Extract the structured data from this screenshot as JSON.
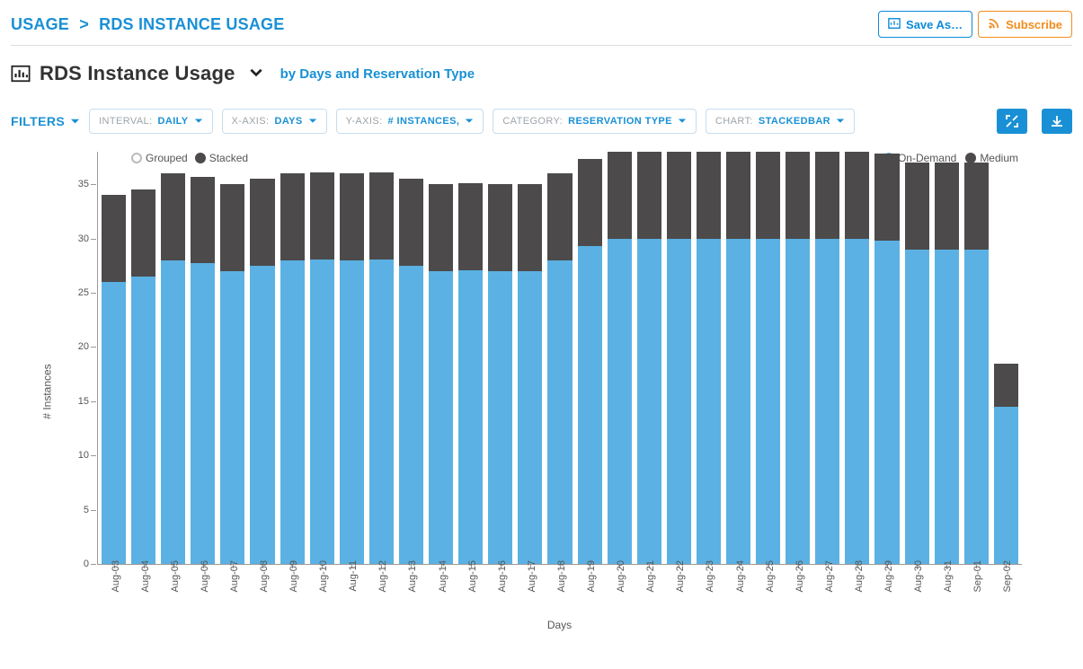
{
  "breadcrumb": {
    "root": "USAGE",
    "leaf": "RDS INSTANCE USAGE",
    "sep": ">"
  },
  "actions": {
    "save": "Save As…",
    "subscribe": "Subscribe"
  },
  "title": {
    "main": "RDS Instance Usage",
    "sub": "by Days and Reservation Type"
  },
  "filters": {
    "label": "FILTERS",
    "chips": [
      {
        "key": "INTERVAL:",
        "val": "DAILY"
      },
      {
        "key": "X-AXIS:",
        "val": "DAYS"
      },
      {
        "key": "Y-AXIS:",
        "val": "# INSTANCES,"
      },
      {
        "key": "CATEGORY:",
        "val": "RESERVATION TYPE"
      },
      {
        "key": "CHART:",
        "val": "STACKEDBAR"
      }
    ]
  },
  "toggle_legend": {
    "grouped": "Grouped",
    "stacked": "Stacked"
  },
  "series_legend": {
    "a": "On-Demand",
    "b": "Medium"
  },
  "colors": {
    "on_demand": "#5BB1E3",
    "medium": "#4C4A4B",
    "accent": "#1990D5"
  },
  "chart_data": {
    "type": "bar",
    "stacked": true,
    "title": "",
    "xlabel": "Days",
    "ylabel": "# Instances",
    "ylim": [
      0,
      38
    ],
    "yticks": [
      0,
      5,
      10,
      15,
      20,
      25,
      30,
      35
    ],
    "categories": [
      "Aug-03",
      "Aug-04",
      "Aug-05",
      "Aug-06",
      "Aug-07",
      "Aug-08",
      "Aug-09",
      "Aug-10",
      "Aug-11",
      "Aug-12",
      "Aug-13",
      "Aug-14",
      "Aug-15",
      "Aug-16",
      "Aug-17",
      "Aug-18",
      "Aug-19",
      "Aug-20",
      "Aug-21",
      "Aug-22",
      "Aug-23",
      "Aug-24",
      "Aug-25",
      "Aug-26",
      "Aug-27",
      "Aug-28",
      "Aug-29",
      "Aug-30",
      "Aug-31",
      "Sep-01",
      "Sep-02"
    ],
    "series": [
      {
        "name": "On-Demand",
        "color": "#5BB1E3",
        "values": [
          26.0,
          26.5,
          28.0,
          27.7,
          27.0,
          27.5,
          28.0,
          28.1,
          28.0,
          28.1,
          27.5,
          27.0,
          27.1,
          27.0,
          27.0,
          28.0,
          29.3,
          30.0,
          30.0,
          30.0,
          30.0,
          30.0,
          30.0,
          30.0,
          30.0,
          30.0,
          29.8,
          29.0,
          29.0,
          29.0,
          14.5
        ]
      },
      {
        "name": "Medium",
        "color": "#4C4A4B",
        "values": [
          8.0,
          8.0,
          8.0,
          8.0,
          8.0,
          8.0,
          8.0,
          8.0,
          8.0,
          8.0,
          8.0,
          8.0,
          8.0,
          8.0,
          8.0,
          8.0,
          8.0,
          8.0,
          8.0,
          8.0,
          8.0,
          8.0,
          8.0,
          8.0,
          8.0,
          8.0,
          8.0,
          8.0,
          8.0,
          8.0,
          4.0
        ]
      }
    ]
  }
}
